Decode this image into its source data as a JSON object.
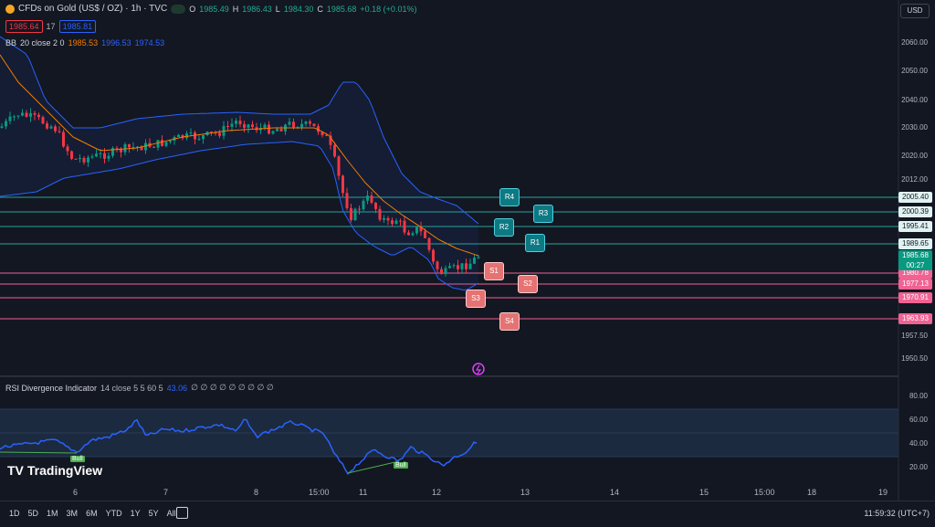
{
  "header": {
    "symbol": "CFDs on Gold (US$ / OZ) · 1h · TVC",
    "ohlc": {
      "o_label": "O",
      "o": "1985.49",
      "h_label": "H",
      "h": "1986.43",
      "l_label": "L",
      "l": "1984.30",
      "c_label": "C",
      "c": "1985.68",
      "change": "+0.18 (+0.01%)"
    },
    "sell_price": "1985.64",
    "spread": "17",
    "buy_price": "1985.81",
    "currency": "USD"
  },
  "bb_legend": {
    "name": "BB",
    "params": "20 close 2 0",
    "basis": "1985.53",
    "upper": "1996.53",
    "lower": "1974.53"
  },
  "rsi_legend": {
    "name": "RSI Divergence Indicator",
    "params": "14 close 5 5 60 5",
    "value": "43.06",
    "nulls": "∅ ∅ ∅ ∅ ∅ ∅ ∅ ∅ ∅"
  },
  "price_axis": [
    "2060.00",
    "2050.00",
    "2040.00",
    "2030.00",
    "2020.00",
    "2012.00",
    "1957.50",
    "1950.50"
  ],
  "rsi_axis": [
    "80.00",
    "60.00",
    "40.00",
    "20.00"
  ],
  "level_tags": [
    {
      "label": "2005.40",
      "kind": "resistance"
    },
    {
      "label": "2000.39",
      "kind": "resistance"
    },
    {
      "label": "1995.41",
      "kind": "resistance"
    },
    {
      "label": "1989.65",
      "kind": "resistance"
    },
    {
      "label": "1980.78",
      "kind": "support"
    },
    {
      "label": "1977.13",
      "kind": "support"
    },
    {
      "label": "1970.91",
      "kind": "support"
    },
    {
      "label": "1963.93",
      "kind": "support"
    }
  ],
  "current_price": {
    "price": "1985.68",
    "countdown": "00:27"
  },
  "pivots": {
    "r1": "R1",
    "r2": "R2",
    "r3": "R3",
    "r4": "R4",
    "s1": "S1",
    "s2": "S2",
    "s3": "S3",
    "s4": "S4"
  },
  "rsi_signals": {
    "first": "Bull",
    "second": "Bull"
  },
  "x_axis": [
    "6",
    "7",
    "8",
    "15:00",
    "11",
    "12",
    "13",
    "14",
    "15",
    "15:00",
    "18",
    "19"
  ],
  "brand": "TradingView",
  "timeframes": [
    "1D",
    "5D",
    "1M",
    "3M",
    "6M",
    "YTD",
    "1Y",
    "5Y",
    "All"
  ],
  "clock": "11:59:32 (UTC+7)",
  "colors": {
    "bg": "#131722",
    "up": "#089981",
    "down": "#f23645",
    "bb": "#2962ff",
    "basis": "#f57c00",
    "resistance": "#26a69a",
    "support": "#f06292",
    "rsi": "#2962ff"
  }
}
